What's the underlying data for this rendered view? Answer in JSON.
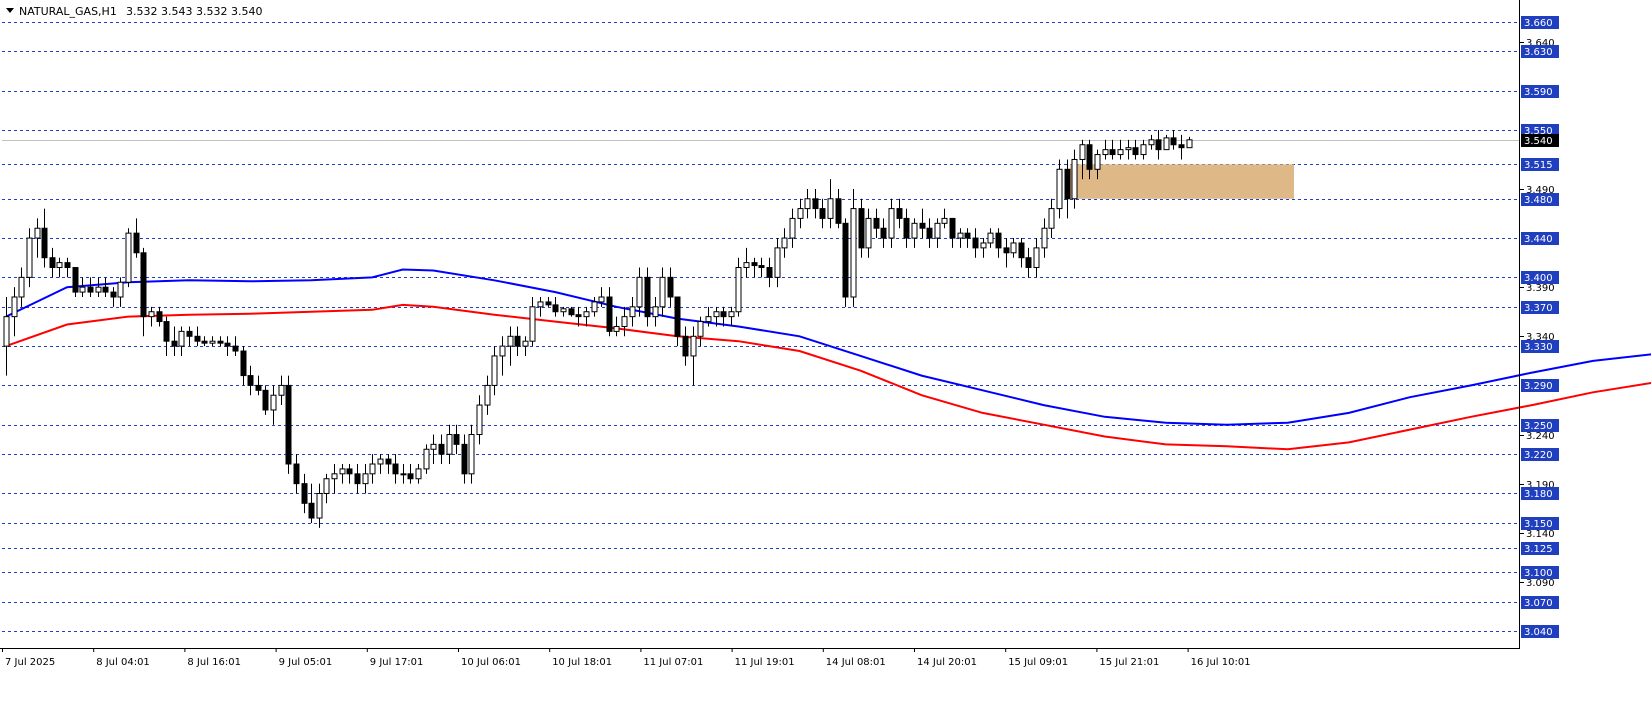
{
  "header": {
    "symbol_timeframe": "NATURAL_GAS,H1",
    "ohlc": "3.532 3.543 3.532 3.540"
  },
  "chart_data": {
    "type": "candlestick",
    "symbol": "NATURAL_GAS",
    "timeframe": "H1",
    "y_range": [
      3.03,
      3.67
    ],
    "y_ticks": [
      "3.640",
      "3.490",
      "3.390",
      "3.340",
      "3.240",
      "3.190",
      "3.140",
      "3.090"
    ],
    "x_labels": [
      "7 Jul 2025",
      "8 Jul 04:01",
      "8 Jul 16:01",
      "9 Jul 05:01",
      "9 Jul 17:01",
      "10 Jul 06:01",
      "10 Jul 18:01",
      "11 Jul 07:01",
      "11 Jul 19:01",
      "14 Jul 08:01",
      "14 Jul 20:01",
      "15 Jul 09:01",
      "15 Jul 21:01",
      "16 Jul 10:01"
    ],
    "current_price": "3.540",
    "levels": [
      "3.660",
      "3.630",
      "3.590",
      "3.550",
      "3.515",
      "3.480",
      "3.440",
      "3.400",
      "3.370",
      "3.330",
      "3.290",
      "3.250",
      "3.220",
      "3.180",
      "3.150",
      "3.125",
      "3.100",
      "3.070",
      "3.040"
    ],
    "zone": {
      "low": 3.48,
      "high": 3.515,
      "color": "#deb887"
    },
    "colors": {
      "bull": "#ffffff",
      "bear": "#000000",
      "level": "#1f3fbf",
      "current": "#c0c0c0",
      "ma_fast": "#0000ff",
      "ma_slow": "#ff0000",
      "label_bg": "#1f3fbf",
      "label_fg": "#ffffff"
    },
    "series": [
      {
        "name": "",
        "color": "#0000ff",
        "points": [
          [
            0,
            3.36
          ],
          [
            8,
            3.39
          ],
          [
            16,
            3.395
          ],
          [
            24,
            3.397
          ],
          [
            32,
            3.396
          ],
          [
            40,
            3.397
          ],
          [
            48,
            3.4
          ],
          [
            52,
            3.408
          ],
          [
            56,
            3.407
          ],
          [
            64,
            3.397
          ],
          [
            72,
            3.385
          ],
          [
            80,
            3.37
          ],
          [
            88,
            3.358
          ],
          [
            96,
            3.35
          ],
          [
            104,
            3.34
          ],
          [
            112,
            3.32
          ],
          [
            120,
            3.3
          ],
          [
            128,
            3.285
          ],
          [
            136,
            3.27
          ],
          [
            144,
            3.258
          ],
          [
            152,
            3.252
          ],
          [
            160,
            3.25
          ],
          [
            168,
            3.252
          ],
          [
            176,
            3.262
          ],
          [
            184,
            3.278
          ],
          [
            192,
            3.29
          ],
          [
            200,
            3.303
          ],
          [
            208,
            3.315
          ],
          [
            216,
            3.322
          ],
          [
            224,
            3.33
          ],
          [
            232,
            3.337
          ],
          [
            240,
            3.345
          ],
          [
            248,
            3.355
          ],
          [
            256,
            3.375
          ],
          [
            264,
            3.395
          ],
          [
            272,
            3.42
          ],
          [
            280,
            3.432
          ],
          [
            288,
            3.437
          ],
          [
            296,
            3.442
          ],
          [
            304,
            3.446
          ],
          [
            312,
            3.444
          ],
          [
            320,
            3.442
          ],
          [
            328,
            3.442
          ],
          [
            336,
            3.44
          ],
          [
            344,
            3.445
          ],
          [
            352,
            3.46
          ],
          [
            360,
            3.47
          ],
          [
            368,
            3.48
          ],
          [
            376,
            3.488
          ],
          [
            384,
            3.495
          ],
          [
            392,
            3.502
          ],
          [
            400,
            3.51
          ]
        ]
      },
      {
        "name": "",
        "color": "#ff0000",
        "points": [
          [
            0,
            3.33
          ],
          [
            8,
            3.352
          ],
          [
            16,
            3.36
          ],
          [
            24,
            3.362
          ],
          [
            32,
            3.363
          ],
          [
            40,
            3.365
          ],
          [
            48,
            3.367
          ],
          [
            52,
            3.372
          ],
          [
            56,
            3.37
          ],
          [
            64,
            3.362
          ],
          [
            72,
            3.355
          ],
          [
            80,
            3.348
          ],
          [
            88,
            3.34
          ],
          [
            96,
            3.335
          ],
          [
            104,
            3.325
          ],
          [
            112,
            3.305
          ],
          [
            120,
            3.28
          ],
          [
            128,
            3.262
          ],
          [
            136,
            3.25
          ],
          [
            144,
            3.238
          ],
          [
            152,
            3.23
          ],
          [
            160,
            3.228
          ],
          [
            168,
            3.225
          ],
          [
            176,
            3.232
          ],
          [
            184,
            3.245
          ],
          [
            192,
            3.258
          ],
          [
            200,
            3.27
          ],
          [
            208,
            3.283
          ],
          [
            216,
            3.293
          ],
          [
            224,
            3.302
          ],
          [
            232,
            3.31
          ],
          [
            240,
            3.316
          ],
          [
            248,
            3.32
          ],
          [
            256,
            3.335
          ],
          [
            264,
            3.352
          ],
          [
            272,
            3.372
          ],
          [
            280,
            3.385
          ],
          [
            288,
            3.393
          ],
          [
            296,
            3.398
          ],
          [
            304,
            3.402
          ],
          [
            312,
            3.404
          ],
          [
            320,
            3.404
          ],
          [
            328,
            3.404
          ],
          [
            336,
            3.404
          ],
          [
            344,
            3.406
          ],
          [
            352,
            3.418
          ],
          [
            360,
            3.43
          ],
          [
            368,
            3.44
          ],
          [
            376,
            3.45
          ],
          [
            384,
            3.456
          ],
          [
            392,
            3.462
          ],
          [
            400,
            3.472
          ]
        ]
      }
    ],
    "candles": [
      [
        3.33,
        3.38,
        3.3,
        3.36
      ],
      [
        3.36,
        3.39,
        3.34,
        3.38
      ],
      [
        3.38,
        3.41,
        3.37,
        3.4
      ],
      [
        3.4,
        3.45,
        3.39,
        3.44
      ],
      [
        3.44,
        3.46,
        3.42,
        3.45
      ],
      [
        3.45,
        3.47,
        3.41,
        3.42
      ],
      [
        3.42,
        3.43,
        3.4,
        3.41
      ],
      [
        3.41,
        3.42,
        3.4,
        3.415
      ],
      [
        3.415,
        3.42,
        3.4,
        3.41
      ],
      [
        3.41,
        3.41,
        3.38,
        3.385
      ],
      [
        3.385,
        3.4,
        3.38,
        3.39
      ],
      [
        3.39,
        3.4,
        3.38,
        3.385
      ],
      [
        3.385,
        3.4,
        3.38,
        3.39
      ],
      [
        3.39,
        3.4,
        3.38,
        3.385
      ],
      [
        3.385,
        3.39,
        3.37,
        3.38
      ],
      [
        3.38,
        3.4,
        3.37,
        3.395
      ],
      [
        3.395,
        3.45,
        3.39,
        3.445
      ],
      [
        3.445,
        3.46,
        3.42,
        3.425
      ],
      [
        3.425,
        3.43,
        3.34,
        3.36
      ],
      [
        3.36,
        3.37,
        3.35,
        3.365
      ],
      [
        3.365,
        3.37,
        3.35,
        3.355
      ],
      [
        3.355,
        3.36,
        3.32,
        3.335
      ],
      [
        3.335,
        3.35,
        3.32,
        3.33
      ],
      [
        3.33,
        3.35,
        3.32,
        3.345
      ],
      [
        3.345,
        3.35,
        3.33,
        3.34
      ],
      [
        3.34,
        3.35,
        3.33,
        3.335
      ],
      [
        3.335,
        3.34,
        3.33,
        3.333
      ],
      [
        3.333,
        3.34,
        3.33,
        3.335
      ],
      [
        3.335,
        3.34,
        3.33,
        3.333
      ],
      [
        3.333,
        3.34,
        3.32,
        3.33
      ],
      [
        3.33,
        3.34,
        3.32,
        3.325
      ],
      [
        3.325,
        3.33,
        3.29,
        3.3
      ],
      [
        3.3,
        3.31,
        3.28,
        3.29
      ],
      [
        3.29,
        3.3,
        3.28,
        3.285
      ],
      [
        3.285,
        3.29,
        3.26,
        3.265
      ],
      [
        3.265,
        3.29,
        3.25,
        3.28
      ],
      [
        3.28,
        3.3,
        3.27,
        3.29
      ],
      [
        3.29,
        3.3,
        3.2,
        3.21
      ],
      [
        3.21,
        3.22,
        3.18,
        3.19
      ],
      [
        3.19,
        3.2,
        3.16,
        3.17
      ],
      [
        3.17,
        3.19,
        3.15,
        3.155
      ],
      [
        3.155,
        3.19,
        3.145,
        3.18
      ],
      [
        3.18,
        3.2,
        3.17,
        3.195
      ],
      [
        3.195,
        3.21,
        3.18,
        3.2
      ],
      [
        3.2,
        3.21,
        3.19,
        3.205
      ],
      [
        3.205,
        3.21,
        3.19,
        3.2
      ],
      [
        3.2,
        3.21,
        3.18,
        3.19
      ],
      [
        3.19,
        3.21,
        3.18,
        3.2
      ],
      [
        3.2,
        3.22,
        3.19,
        3.21
      ],
      [
        3.21,
        3.22,
        3.2,
        3.215
      ],
      [
        3.215,
        3.22,
        3.2,
        3.21
      ],
      [
        3.21,
        3.22,
        3.19,
        3.2
      ],
      [
        3.2,
        3.21,
        3.19,
        3.2
      ],
      [
        3.2,
        3.21,
        3.19,
        3.195
      ],
      [
        3.195,
        3.21,
        3.19,
        3.205
      ],
      [
        3.205,
        3.23,
        3.2,
        3.225
      ],
      [
        3.225,
        3.24,
        3.21,
        3.23
      ],
      [
        3.23,
        3.24,
        3.21,
        3.22
      ],
      [
        3.22,
        3.25,
        3.21,
        3.24
      ],
      [
        3.24,
        3.25,
        3.22,
        3.23
      ],
      [
        3.23,
        3.24,
        3.19,
        3.2
      ],
      [
        3.2,
        3.25,
        3.19,
        3.24
      ],
      [
        3.24,
        3.28,
        3.23,
        3.27
      ],
      [
        3.27,
        3.3,
        3.26,
        3.29
      ],
      [
        3.29,
        3.33,
        3.28,
        3.32
      ],
      [
        3.32,
        3.34,
        3.3,
        3.33
      ],
      [
        3.33,
        3.35,
        3.31,
        3.34
      ],
      [
        3.34,
        3.35,
        3.32,
        3.33
      ],
      [
        3.33,
        3.34,
        3.32,
        3.335
      ],
      [
        3.335,
        3.38,
        3.33,
        3.37
      ],
      [
        3.37,
        3.38,
        3.36,
        3.375
      ],
      [
        3.375,
        3.38,
        3.37,
        3.372
      ],
      [
        3.372,
        3.38,
        3.36,
        3.365
      ],
      [
        3.365,
        3.37,
        3.36,
        3.368
      ],
      [
        3.368,
        3.37,
        3.36,
        3.362
      ],
      [
        3.362,
        3.37,
        3.35,
        3.36
      ],
      [
        3.36,
        3.37,
        3.35,
        3.365
      ],
      [
        3.365,
        3.38,
        3.36,
        3.375
      ],
      [
        3.375,
        3.39,
        3.37,
        3.38
      ],
      [
        3.38,
        3.39,
        3.34,
        3.345
      ],
      [
        3.345,
        3.36,
        3.34,
        3.35
      ],
      [
        3.35,
        3.37,
        3.34,
        3.36
      ],
      [
        3.36,
        3.38,
        3.35,
        3.37
      ],
      [
        3.37,
        3.41,
        3.36,
        3.4
      ],
      [
        3.4,
        3.41,
        3.35,
        3.36
      ],
      [
        3.36,
        3.38,
        3.35,
        3.37
      ],
      [
        3.37,
        3.41,
        3.36,
        3.4
      ],
      [
        3.4,
        3.41,
        3.37,
        3.38
      ],
      [
        3.38,
        3.38,
        3.33,
        3.34
      ],
      [
        3.34,
        3.35,
        3.31,
        3.32
      ],
      [
        3.32,
        3.35,
        3.29,
        3.34
      ],
      [
        3.34,
        3.36,
        3.33,
        3.355
      ],
      [
        3.355,
        3.37,
        3.35,
        3.36
      ],
      [
        3.36,
        3.37,
        3.35,
        3.365
      ],
      [
        3.365,
        3.37,
        3.35,
        3.36
      ],
      [
        3.36,
        3.37,
        3.35,
        3.365
      ],
      [
        3.365,
        3.42,
        3.36,
        3.41
      ],
      [
        3.41,
        3.43,
        3.4,
        3.415
      ],
      [
        3.415,
        3.42,
        3.4,
        3.412
      ],
      [
        3.412,
        3.42,
        3.4,
        3.41
      ],
      [
        3.41,
        3.42,
        3.39,
        3.4
      ],
      [
        3.4,
        3.44,
        3.39,
        3.43
      ],
      [
        3.43,
        3.45,
        3.42,
        3.44
      ],
      [
        3.44,
        3.47,
        3.43,
        3.46
      ],
      [
        3.46,
        3.48,
        3.45,
        3.47
      ],
      [
        3.47,
        3.49,
        3.46,
        3.48
      ],
      [
        3.48,
        3.49,
        3.46,
        3.47
      ],
      [
        3.47,
        3.48,
        3.45,
        3.46
      ],
      [
        3.46,
        3.5,
        3.45,
        3.48
      ],
      [
        3.48,
        3.49,
        3.45,
        3.455
      ],
      [
        3.455,
        3.46,
        3.37,
        3.38
      ],
      [
        3.38,
        3.49,
        3.37,
        3.47
      ],
      [
        3.47,
        3.48,
        3.42,
        3.43
      ],
      [
        3.43,
        3.47,
        3.42,
        3.46
      ],
      [
        3.46,
        3.47,
        3.44,
        3.45
      ],
      [
        3.45,
        3.46,
        3.43,
        3.44
      ],
      [
        3.44,
        3.48,
        3.43,
        3.47
      ],
      [
        3.47,
        3.48,
        3.45,
        3.46
      ],
      [
        3.46,
        3.47,
        3.43,
        3.44
      ],
      [
        3.44,
        3.46,
        3.43,
        3.455
      ],
      [
        3.455,
        3.47,
        3.44,
        3.45
      ],
      [
        3.45,
        3.46,
        3.43,
        3.44
      ],
      [
        3.44,
        3.46,
        3.43,
        3.455
      ],
      [
        3.455,
        3.47,
        3.45,
        3.46
      ],
      [
        3.46,
        3.46,
        3.43,
        3.44
      ],
      [
        3.44,
        3.45,
        3.43,
        3.445
      ],
      [
        3.445,
        3.45,
        3.43,
        3.44
      ],
      [
        3.44,
        3.45,
        3.42,
        3.43
      ],
      [
        3.43,
        3.44,
        3.42,
        3.435
      ],
      [
        3.435,
        3.45,
        3.43,
        3.445
      ],
      [
        3.445,
        3.45,
        3.42,
        3.43
      ],
      [
        3.43,
        3.44,
        3.41,
        3.425
      ],
      [
        3.425,
        3.44,
        3.42,
        3.435
      ],
      [
        3.435,
        3.44,
        3.41,
        3.42
      ],
      [
        3.42,
        3.43,
        3.4,
        3.41
      ],
      [
        3.41,
        3.44,
        3.4,
        3.43
      ],
      [
        3.43,
        3.46,
        3.42,
        3.45
      ],
      [
        3.45,
        3.48,
        3.44,
        3.47
      ],
      [
        3.47,
        3.52,
        3.46,
        3.51
      ],
      [
        3.51,
        3.52,
        3.46,
        3.48
      ],
      [
        3.48,
        3.53,
        3.47,
        3.52
      ],
      [
        3.52,
        3.54,
        3.5,
        3.535
      ],
      [
        3.535,
        3.54,
        3.5,
        3.51
      ],
      [
        3.51,
        3.53,
        3.5,
        3.525
      ],
      [
        3.525,
        3.54,
        3.52,
        3.53
      ],
      [
        3.53,
        3.54,
        3.52,
        3.525
      ],
      [
        3.525,
        3.54,
        3.52,
        3.53
      ],
      [
        3.53,
        3.54,
        3.52,
        3.532
      ],
      [
        3.532,
        3.54,
        3.52,
        3.525
      ],
      [
        3.525,
        3.54,
        3.52,
        3.535
      ],
      [
        3.535,
        3.545,
        3.53,
        3.54
      ],
      [
        3.54,
        3.55,
        3.52,
        3.53
      ],
      [
        3.53,
        3.545,
        3.53,
        3.542
      ],
      [
        3.542,
        3.55,
        3.53,
        3.535
      ],
      [
        3.535,
        3.545,
        3.52,
        3.532
      ],
      [
        3.532,
        3.543,
        3.532,
        3.54
      ]
    ]
  }
}
